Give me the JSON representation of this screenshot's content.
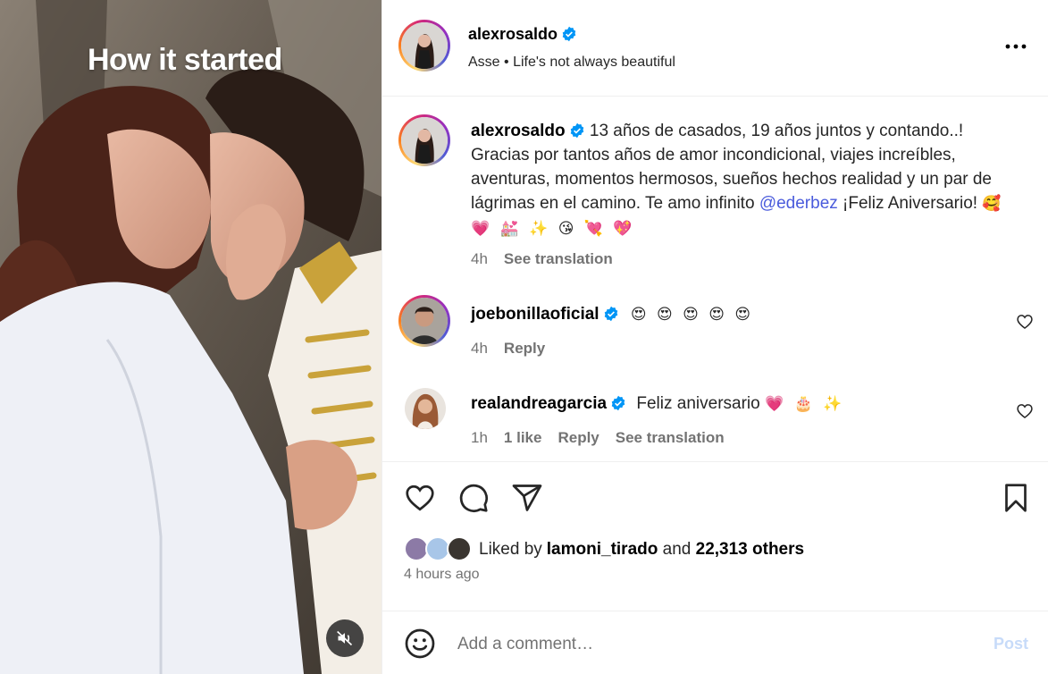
{
  "media": {
    "overlay_text": "How it started"
  },
  "header": {
    "username": "alexrosaldo",
    "subtitle": "Asse • Life's not always beautiful"
  },
  "caption": {
    "username": "alexrosaldo",
    "text_before_mention": "13 años de casados, 19 años juntos y contando..! Gracias por tantos años de amor incondicional, viajes increíbles, aventuras, momentos hermosos, sueños hechos realidad y un par de lágrimas en el camino. Te amo infinito ",
    "mention": "@ederbez",
    "text_after_mention": " ¡Feliz Aniversario! ",
    "emojis": "🥰 💗 💒 ✨ 😘 💘 💖",
    "time": "4h",
    "see_translation": "See translation"
  },
  "comments": [
    {
      "username": "joebonillaoficial",
      "text": "😍 😍 😍 😍 😍",
      "time": "4h",
      "reply": "Reply"
    },
    {
      "username": "realandreagarcia",
      "text": "Feliz aniversario ",
      "emojis": "💗 🎂 ✨",
      "time": "1h",
      "likes": "1 like",
      "reply": "Reply",
      "see_translation": "See translation"
    }
  ],
  "likes": {
    "prefix": "Liked by ",
    "user": "lamoni_tirado",
    "middle": " and ",
    "count": "22,313 others"
  },
  "time_ago": "4 hours ago",
  "add_comment": {
    "placeholder": "Add a comment…",
    "post_label": "Post"
  },
  "colors": {
    "verified": "#0095f6",
    "mention": "#4a5bdc",
    "muted": "#737373",
    "post_disabled": "#c7dbf9"
  }
}
